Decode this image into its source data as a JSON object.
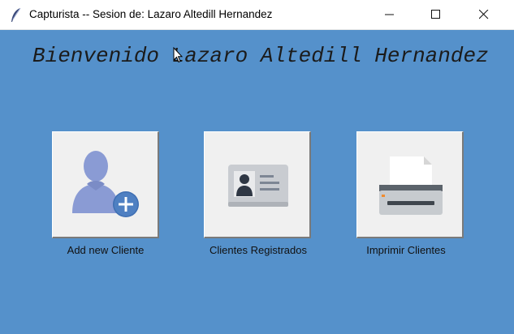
{
  "window": {
    "title": "Capturista -- Sesion de: Lazaro Altedill Hernandez",
    "app_icon": "feather-icon",
    "controls": [
      "minimize-icon",
      "maximize-icon",
      "close-icon"
    ]
  },
  "main": {
    "welcome_text": "Bienvenido Lazaro Altedill Hernandez",
    "background_color": "#5591cb",
    "buttons": [
      {
        "label": "Add new Cliente",
        "icon": "add-user-icon"
      },
      {
        "label": "Clientes Registrados",
        "icon": "id-card-icon"
      },
      {
        "label": "Imprimir Clientes",
        "icon": "printer-icon"
      }
    ]
  }
}
